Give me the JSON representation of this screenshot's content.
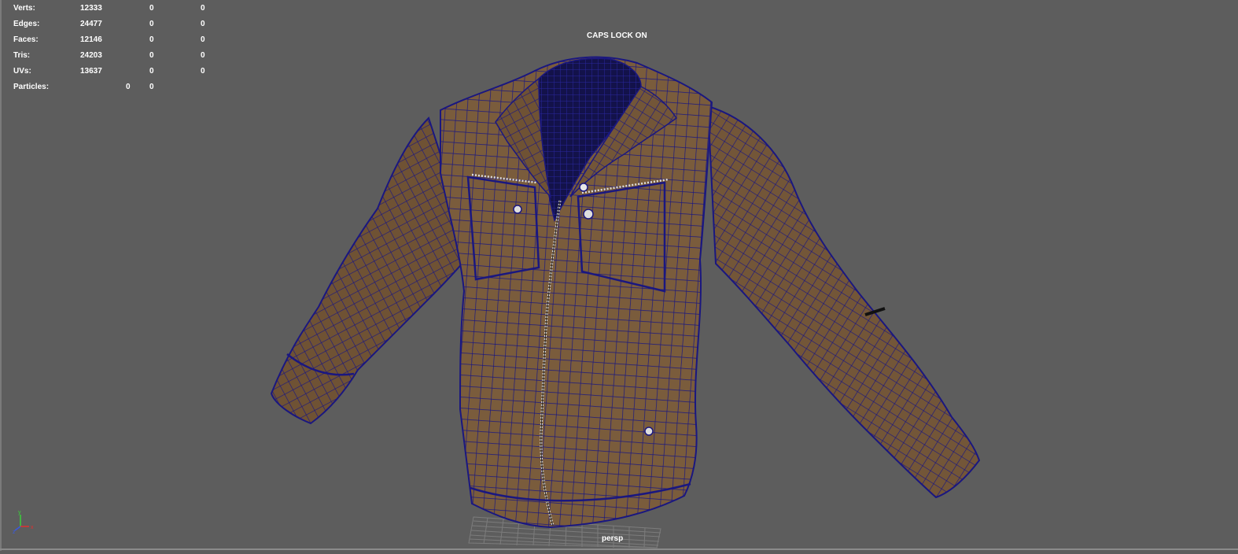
{
  "heads_up_display": {
    "poly_count": [
      {
        "label": "Verts:",
        "total": "12333",
        "selected": "0",
        "component": "0"
      },
      {
        "label": "Edges:",
        "total": "24477",
        "selected": "0",
        "component": "0"
      },
      {
        "label": "Faces:",
        "total": "12146",
        "selected": "0",
        "component": "0"
      },
      {
        "label": "Tris:",
        "total": "24203",
        "selected": "0",
        "component": "0"
      },
      {
        "label": "UVs:",
        "total": "13637",
        "selected": "0",
        "component": "0"
      }
    ],
    "particles": {
      "label": "Particles:",
      "value1": "0",
      "value2": "0"
    }
  },
  "caps_lock_message": "CAPS LOCK ON",
  "camera_name": "persp",
  "axis_gizmo": {
    "x_label": "x",
    "y_label": "y",
    "z_label": "z"
  },
  "colors": {
    "viewport_bg": "#5d5d5d",
    "mesh_fill": "#7a5c3c",
    "wireframe": "#1a1780",
    "grid": "#7c7c7c"
  },
  "model": {
    "name": "jacket-mesh",
    "display_mode": "shaded-with-wireframe"
  }
}
